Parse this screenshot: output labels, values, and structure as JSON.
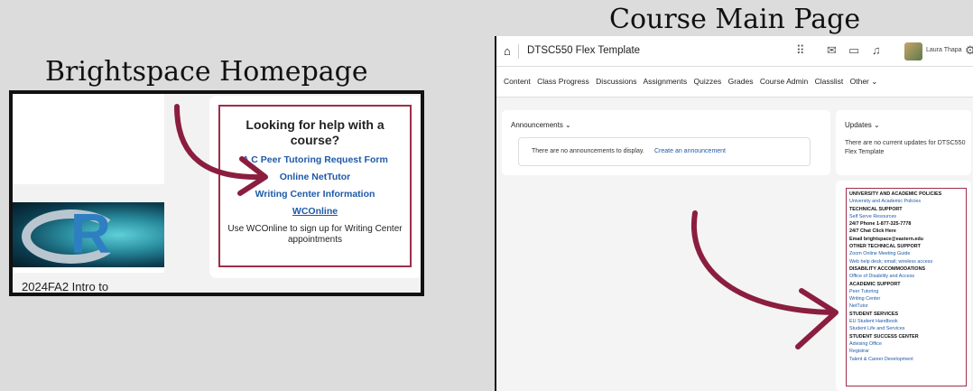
{
  "captions": {
    "left": "Brightspace Homepage",
    "right": "Course Main Page"
  },
  "homepage": {
    "course_name": "2024FA2 Intro to",
    "tile_letter": "R",
    "help": {
      "title": "Looking for help with a course?",
      "links": [
        "A C Peer Tutoring Request Form",
        "Online NetTutor",
        "Writing Center Information",
        "WCOnline"
      ],
      "note": "Use WCOnline to sign up for Writing Center appointments"
    }
  },
  "course_page": {
    "home_icon": "home-icon",
    "title": "DTSC550 Flex Template",
    "user_name": "Laura Thapa",
    "nav": [
      "Content",
      "Class Progress",
      "Discussions",
      "Assignments",
      "Quizzes",
      "Grades",
      "Course Admin",
      "Classlist",
      "Other ⌄"
    ],
    "announcements": {
      "heading": "Announcements ⌄",
      "empty": "There are no announcements to display.",
      "create_link": "Create an announcement"
    },
    "updates": {
      "heading": "Updates ⌄",
      "text": "There are no current updates for DTSC550 Flex Template"
    },
    "resources": [
      {
        "type": "h",
        "text": "UNIVERSITY AND ACADEMIC POLICIES"
      },
      {
        "type": "l",
        "text": "University and Academic Policies"
      },
      {
        "type": "h",
        "text": "TECHNICAL SUPPORT"
      },
      {
        "type": "l",
        "text": "Self Serve Resources"
      },
      {
        "type": "h",
        "text": "24/7 Phone 1-877-325-7778"
      },
      {
        "type": "h",
        "text": "24/7 Chat Click Here"
      },
      {
        "type": "h",
        "text": "Email brightspace@eastern.edu"
      },
      {
        "type": "h",
        "text": "OTHER TECHNICAL SUPPORT"
      },
      {
        "type": "l",
        "text": "Zoom Online Meeting Guide"
      },
      {
        "type": "l",
        "text": "Web help desk; email; wireless access"
      },
      {
        "type": "h",
        "text": "DISABILITY ACCOMMODATIONS"
      },
      {
        "type": "l",
        "text": "Office of Disability and Access"
      },
      {
        "type": "h",
        "text": "ACADEMIC SUPPORT"
      },
      {
        "type": "l",
        "text": "Peer Tutoring"
      },
      {
        "type": "l",
        "text": "Writing Center"
      },
      {
        "type": "l",
        "text": "NetTutor"
      },
      {
        "type": "h",
        "text": "STUDENT SERVICES"
      },
      {
        "type": "l",
        "text": "EU Student Handbook"
      },
      {
        "type": "l",
        "text": "Student Life and Services"
      },
      {
        "type": "h",
        "text": "STUDENT SUCCESS CENTER"
      },
      {
        "type": "l",
        "text": "Advising Office"
      },
      {
        "type": "l",
        "text": "Registrar"
      },
      {
        "type": "l",
        "text": "Talent & Career Development"
      }
    ]
  },
  "colors": {
    "background": "#dcdcdc",
    "accent": "#8b1e3f",
    "link": "#1e5aa8"
  }
}
